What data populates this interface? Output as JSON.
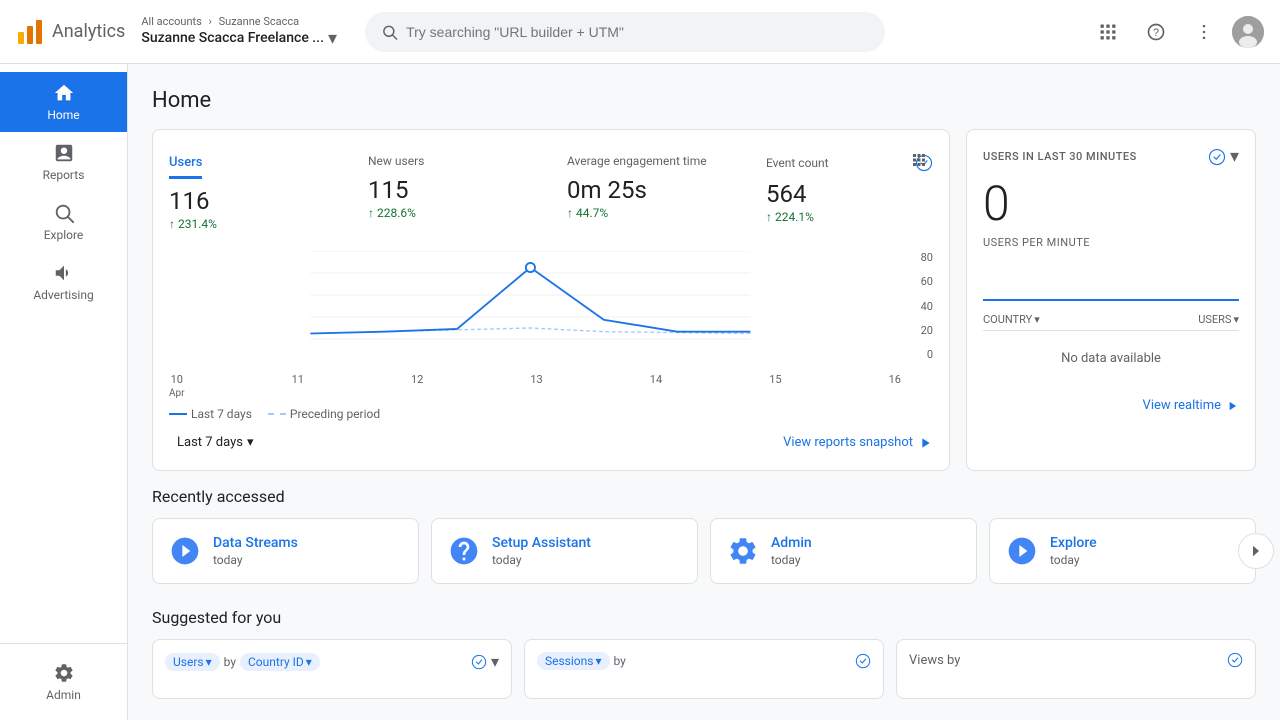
{
  "topbar": {
    "logo_text": "Analytics",
    "breadcrumb_all": "All accounts",
    "breadcrumb_sep": "›",
    "breadcrumb_account": "Suzanne Scacca",
    "account_name": "Suzanne Scacca Freelance ...",
    "search_placeholder": "Try searching \"URL builder + UTM\"",
    "apps_icon": "⊞",
    "help_icon": "?",
    "more_icon": "⋮"
  },
  "sidebar": {
    "items": [
      {
        "id": "home",
        "label": "Home",
        "icon": "🏠",
        "active": true
      },
      {
        "id": "reports",
        "label": "Reports",
        "icon": "📊",
        "active": false
      },
      {
        "id": "explore",
        "label": "Explore",
        "icon": "🔍",
        "active": false
      },
      {
        "id": "advertising",
        "label": "Advertising",
        "icon": "📣",
        "active": false
      }
    ],
    "admin_label": "Admin",
    "admin_icon": "⚙️"
  },
  "home": {
    "title": "Home",
    "stats": {
      "tabs": [
        "Users",
        "New users",
        "Average engagement time",
        "Event count"
      ],
      "metrics": [
        {
          "label": "Users",
          "value": "116",
          "change": "231.4%"
        },
        {
          "label": "New users",
          "value": "115",
          "change": "228.6%"
        },
        {
          "label": "Average engagement time",
          "value": "0m 25s",
          "change": "44.7%"
        },
        {
          "label": "Event count",
          "value": "564",
          "change": "224.1%"
        }
      ],
      "chart": {
        "x_labels": [
          "10\nApr",
          "11",
          "12",
          "13",
          "14",
          "15",
          "16"
        ],
        "y_labels": [
          "0",
          "20",
          "40",
          "60",
          "80"
        ],
        "legend": [
          "Last 7 days",
          "Preceding period"
        ]
      },
      "period_label": "Last 7 days",
      "view_snapshot": "View reports snapshot"
    },
    "realtime": {
      "label": "USERS IN LAST 30 MINUTES",
      "value": "0",
      "sub_label": "USERS PER MINUTE",
      "country_filter": "COUNTRY",
      "users_filter": "USERS",
      "no_data": "No data available",
      "view_realtime": "View realtime"
    },
    "recently_accessed": {
      "title": "Recently accessed",
      "items": [
        {
          "name": "Data Streams",
          "time": "today",
          "icon_color": "#4285f4"
        },
        {
          "name": "Setup Assistant",
          "time": "today",
          "icon_color": "#4285f4"
        },
        {
          "name": "Admin",
          "time": "today",
          "icon_color": "#4285f4"
        },
        {
          "name": "Explore",
          "time": "today",
          "icon_color": "#4285f4"
        }
      ]
    },
    "suggested": {
      "title": "Suggested for you",
      "cards": [
        {
          "label": "Users",
          "filter": "by Country ID",
          "has_arrow": true
        },
        {
          "label": "Sessions",
          "filter": "by",
          "has_arrow": false
        },
        {
          "label": "Views by",
          "has_arrow": false
        }
      ]
    }
  }
}
